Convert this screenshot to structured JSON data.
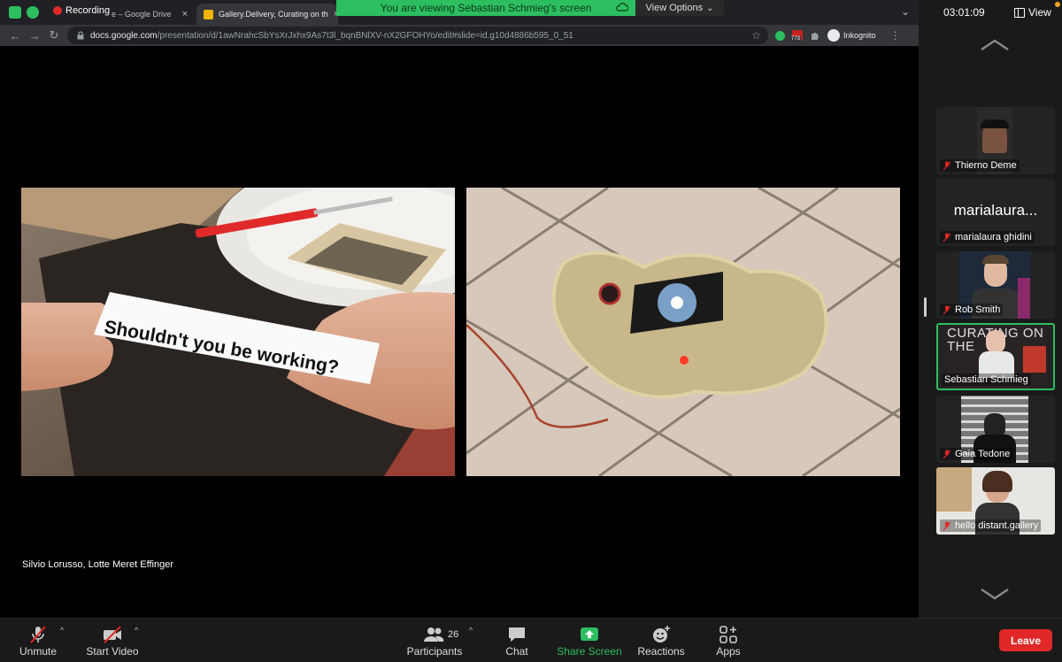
{
  "browser": {
    "recording_label": "Recording",
    "tabs": [
      {
        "title": "e – Google Drive",
        "close": "×"
      },
      {
        "title": "Gallery.Delivery, Curating on th",
        "close": "×"
      },
      {
        "title": "",
        "close": "×"
      }
    ],
    "url_host": "docs.google.com",
    "url_path": "/presentation/d/1awNrahcSbYsXrJxhx9As7t3l_bqnBNlXV-nX2GFOHYo/edit#slide=id.g10d4886b595_0_51",
    "extension_badge": "773",
    "incognito_label": "Inkognito"
  },
  "banner": {
    "viewing_text": "You are viewing Sebastian Schmieg's screen",
    "view_options_label": "View Options"
  },
  "slide": {
    "note_text": "Shouldn't you be working?",
    "caption": "Silvio Lorusso, Lotte Meret Effinger"
  },
  "panel": {
    "meeting_time": "03:01:09",
    "view_label": "View",
    "participants": [
      {
        "name": "Thierno Deme",
        "muted": true
      },
      {
        "name": "marialaura ghidini",
        "display": "marialaura...",
        "muted": true
      },
      {
        "name": "Rob Smith",
        "muted": true
      },
      {
        "name": "Sebastian Schmieg",
        "muted": false,
        "active": true,
        "bg_text": "CURATING ON THE"
      },
      {
        "name": "Gaia Tedone",
        "muted": true
      },
      {
        "name": "hello distant.gallery",
        "muted": true
      }
    ]
  },
  "toolbar": {
    "unmute_label": "Unmute",
    "start_video_label": "Start Video",
    "participants_label": "Participants",
    "participants_count": "26",
    "chat_label": "Chat",
    "share_screen_label": "Share Screen",
    "reactions_label": "Reactions",
    "apps_label": "Apps",
    "leave_label": "Leave"
  },
  "colors": {
    "zoom_green": "#2dbe60",
    "leave_red": "#e02828",
    "chrome_dark": "#202124"
  }
}
